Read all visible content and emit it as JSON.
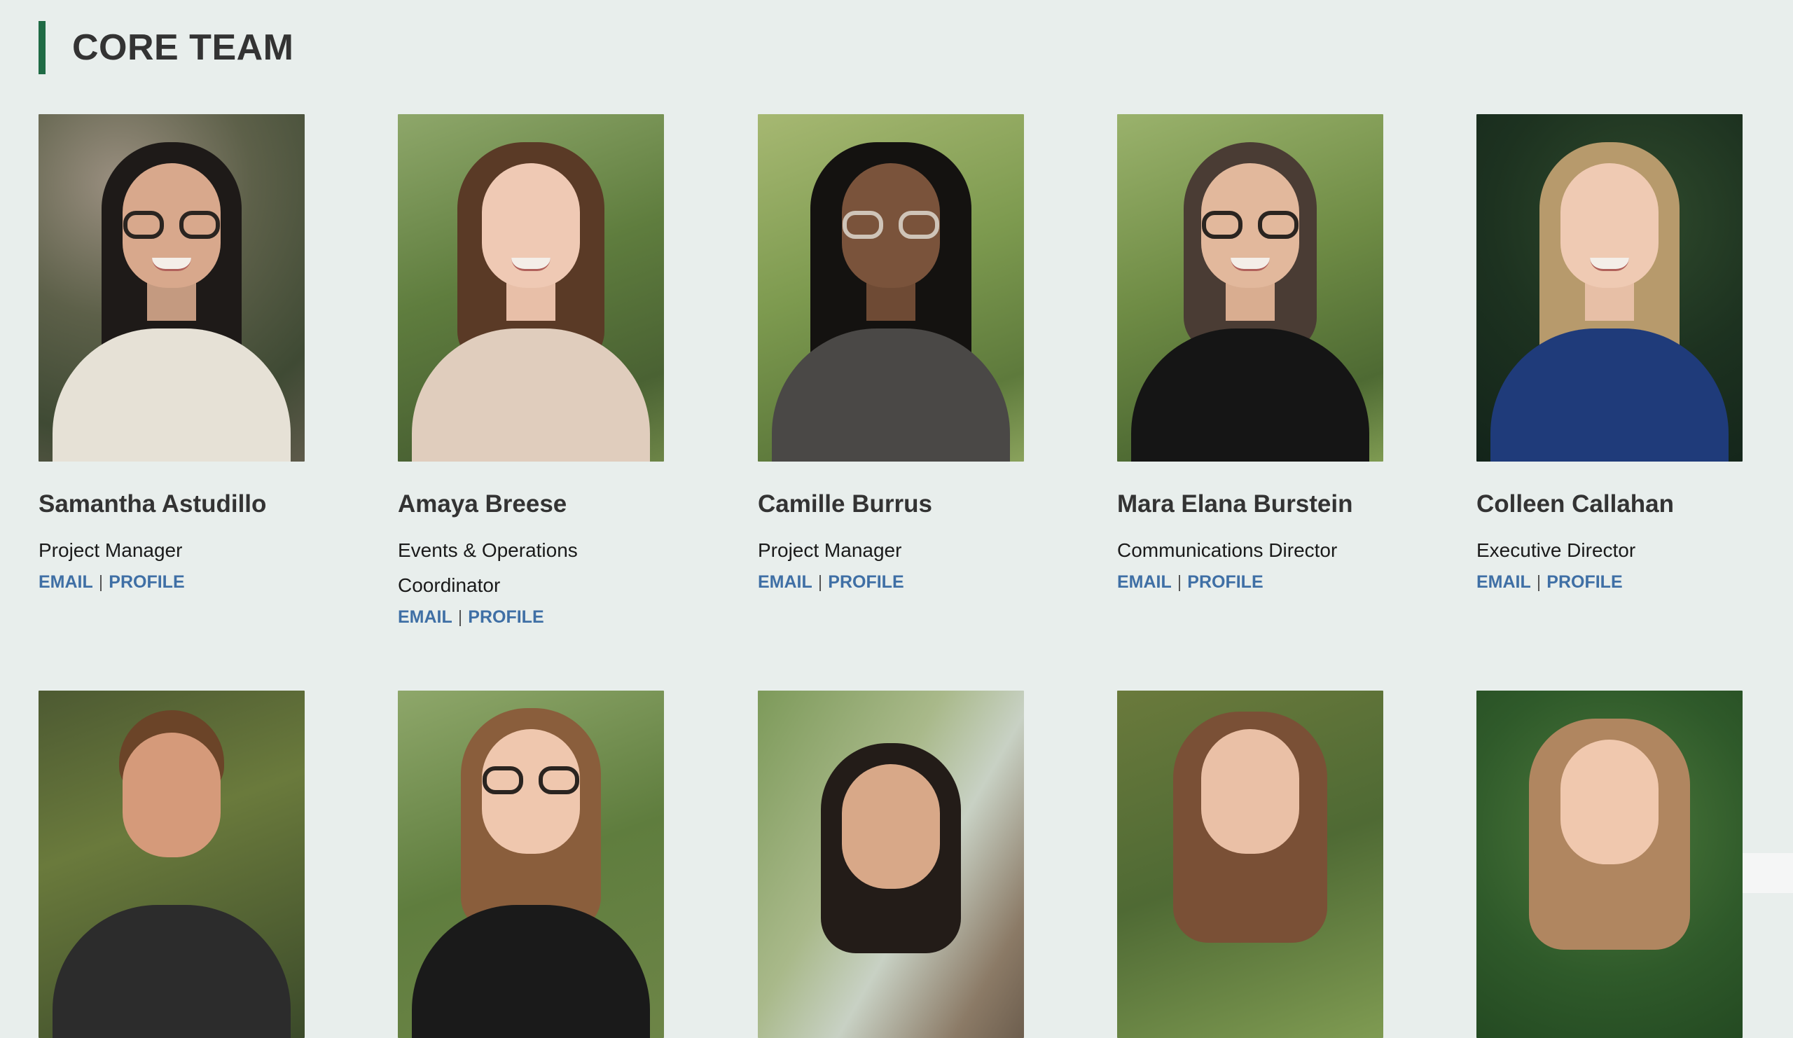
{
  "section": {
    "title": "CORE TEAM",
    "accent_color": "#1f6b45"
  },
  "link_color": "#3f6fa5",
  "team_row_1": [
    {
      "name": "Samantha Astudillo",
      "role": "Project Manager",
      "email_label": "EMAIL",
      "separator": "|",
      "profile_label": "PROFILE"
    },
    {
      "name": "Amaya Breese",
      "role": "Events & Operations Coordinator",
      "email_label": "EMAIL",
      "separator": "|",
      "profile_label": "PROFILE"
    },
    {
      "name": "Camille Burrus",
      "role": "Project Manager",
      "email_label": "EMAIL",
      "separator": "|",
      "profile_label": "PROFILE"
    },
    {
      "name": "Mara Elana Burstein",
      "role": "Communications Director",
      "email_label": "EMAIL",
      "separator": "|",
      "profile_label": "PROFILE"
    },
    {
      "name": "Colleen Callahan",
      "role": "Executive Director",
      "email_label": "EMAIL",
      "separator": "|",
      "profile_label": "PROFILE"
    }
  ],
  "team_row_2_photos": [
    "person-photo",
    "person-photo",
    "person-photo",
    "person-photo",
    "person-photo"
  ]
}
